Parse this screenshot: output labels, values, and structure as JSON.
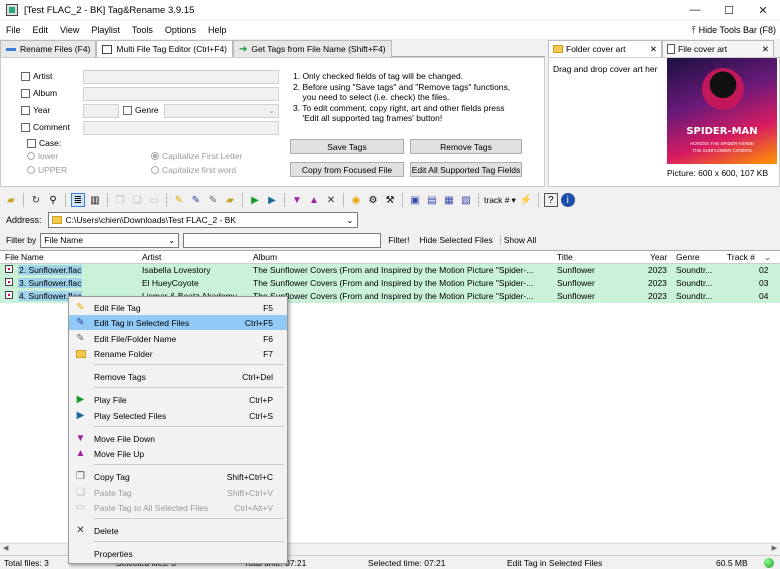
{
  "window": {
    "title": "[Test FLAC_2 - BK] Tag&Rename 3.9.15",
    "min": "—",
    "max": "☐",
    "close": "✕"
  },
  "menu": [
    "File",
    "Edit",
    "View",
    "Playlist",
    "Tools",
    "Options",
    "Help"
  ],
  "hide_toolbar": "Hide Tools Bar (F8)",
  "tabs": [
    "Rename Files (F4)",
    "Multi File Tag Editor (Ctrl+F4)",
    "Get Tags from File Name (Shift+F4)"
  ],
  "editor": {
    "fields": [
      "Artist",
      "Album",
      "Year",
      "Genre",
      "Comment"
    ],
    "case_label": "Case:",
    "case_options": [
      "lower",
      "UPPER",
      "Capitalize First Letter",
      "Capitalize first word"
    ],
    "info": [
      "1. Only checked fields of tag will be changed.",
      "2. Before using \"Save tags\" and \"Remove tags\" functions,",
      "    you need to select (i.e. check) the files.",
      "3. To edit comment, copy right, art and other fields press",
      "    'Edit all supported tag frames' button!"
    ],
    "buttons": {
      "save": "Save Tags",
      "remove": "Remove Tags",
      "copy_focused": "Copy from Focused File",
      "edit_all": "Edit All Supported Tag Fields"
    }
  },
  "cover": {
    "tabs": [
      "Folder cover art",
      "File cover art"
    ],
    "hint": "Drag and drop cover art her",
    "art_title": "SPIDER-MAN",
    "art_sub": "ACROSS THE SPIDER-VERSE",
    "art_sub2": "THE SUNFLOWER COVERS",
    "picture_info": "Picture: 600 x 600, 107 KB"
  },
  "toolbar": {
    "track_label": "track #"
  },
  "address": {
    "label": "Address:",
    "path": "C:\\Users\\chien\\Downloads\\Test FLAC_2 - BK"
  },
  "filter": {
    "label": "Filter by",
    "field": "File Name",
    "go": "Filter!",
    "hide_selected": "Hide Selected Files",
    "show_all": "Show All"
  },
  "grid": {
    "columns": [
      "File Name",
      "Artist",
      "Album",
      "Title",
      "Year",
      "Genre",
      "Track #"
    ],
    "rows": [
      {
        "file": "2. Sunflower.flac",
        "artist": "Isabella Lovestory",
        "album": "The Sunflower Covers (From and Inspired by the Motion Picture \"Spider-...",
        "title": "Sunflower",
        "year": "2023",
        "genre": "Soundtr...",
        "track": "02"
      },
      {
        "file": "3. Sunflower.flac",
        "artist": "El HueyCoyote",
        "album": "The Sunflower Covers (From and Inspired by the Motion Picture \"Spider-...",
        "title": "Sunflower",
        "year": "2023",
        "genre": "Soundtr...",
        "track": "03"
      },
      {
        "file": "4. Sunflower.flac",
        "artist": "Lismar & Beatz Akademy",
        "album": "The Sunflower Covers (From and Inspired by the Motion Picture \"Spider-...",
        "title": "Sunflower",
        "year": "2023",
        "genre": "Soundtr...",
        "track": "04"
      }
    ]
  },
  "context_menu": [
    {
      "label": "Edit File Tag",
      "shortcut": "F5"
    },
    {
      "label": "Edit Tag in Selected Files",
      "shortcut": "Ctrl+F5"
    },
    {
      "label": "Edit File/Folder Name",
      "shortcut": "F6"
    },
    {
      "label": "Rename Folder",
      "shortcut": "F7"
    },
    {
      "label": "Remove Tags",
      "shortcut": "Ctrl+Del"
    },
    {
      "label": "Play File",
      "shortcut": "Ctrl+P"
    },
    {
      "label": "Play Selected Files",
      "shortcut": "Ctrl+S"
    },
    {
      "label": "Move File Down",
      "shortcut": ""
    },
    {
      "label": "Move File Up",
      "shortcut": ""
    },
    {
      "label": "Copy Tag",
      "shortcut": "Shift+Ctrl+C"
    },
    {
      "label": "Paste Tag",
      "shortcut": "Shift+Ctrl+V"
    },
    {
      "label": "Paste Tag to All Selected Files",
      "shortcut": "Ctrl+Alt+V"
    },
    {
      "label": "Delete",
      "shortcut": ""
    },
    {
      "label": "Properties",
      "shortcut": ""
    }
  ],
  "status": {
    "total_files": "Total files: 3",
    "selected_files": "Selected files: 3",
    "total_time": "Total time: 07:21",
    "selected_time": "Selected time: 07:21",
    "action": "Edit Tag in Selected Files",
    "memory": "60.5 MB"
  },
  "colors": {
    "row_bg": "#c9f2d8",
    "filename_bg": "#9fd3ec",
    "menu_highlight": "#91c9f7"
  }
}
